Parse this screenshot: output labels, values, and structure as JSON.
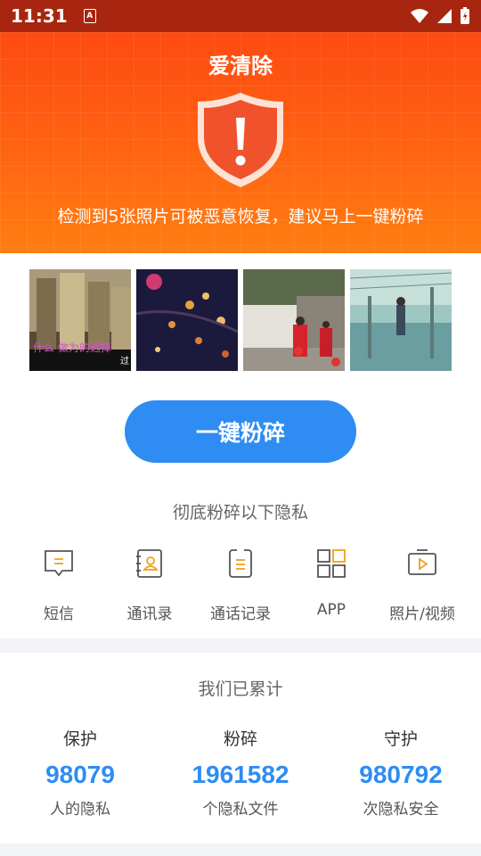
{
  "status_bar": {
    "time": "11:31",
    "a_badge": "A"
  },
  "header": {
    "title": "爱清除",
    "warning": "检测到5张照片可被恶意恢复，建议马上一键粉碎",
    "colors": {
      "top": "#fe4a12",
      "bottom": "#ff8410"
    }
  },
  "photos": [
    {
      "name": "photo-city-karaoke",
      "caption": "什么 做为的选择"
    },
    {
      "name": "photo-night-blossoms"
    },
    {
      "name": "photo-village-lanterns"
    },
    {
      "name": "photo-anime-rain"
    }
  ],
  "shred_button": {
    "label": "一键粉碎",
    "color": "#2e8cf3"
  },
  "privacy_section": {
    "subtitle": "彻底粉碎以下隐私",
    "categories": [
      {
        "label": "短信",
        "icon": "message-icon"
      },
      {
        "label": "通讯录",
        "icon": "contacts-icon"
      },
      {
        "label": "通话记录",
        "icon": "call-log-icon"
      },
      {
        "label": "APP",
        "icon": "apps-grid-icon"
      },
      {
        "label": "照片/视频",
        "icon": "video-icon"
      }
    ]
  },
  "stats": {
    "title": "我们已累计",
    "items": [
      {
        "head": "保护",
        "value": "98079",
        "desc": "人的隐私"
      },
      {
        "head": "粉碎",
        "value": "1961582",
        "desc": "个隐私文件"
      },
      {
        "head": "守护",
        "value": "980792",
        "desc": "次隐私安全"
      }
    ]
  }
}
